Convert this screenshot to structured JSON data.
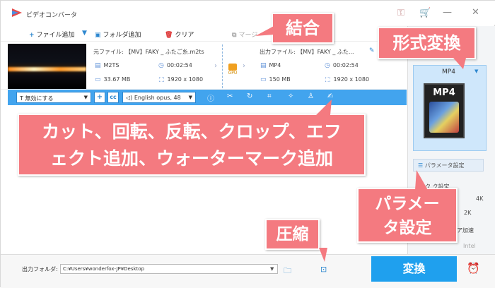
{
  "window": {
    "title": "ビデオコンバータ"
  },
  "toolbar": {
    "add_file": "ファイル追加",
    "add_folder": "フォルダ追加",
    "clear": "クリア",
    "merge": "マージ"
  },
  "file": {
    "source_label": "元ファイル:",
    "source_name": "【MV】FAKY _ ふたご糸.m2ts",
    "source_format": "M2TS",
    "source_duration": "00:02:54",
    "source_size": "33.67 MB",
    "source_resolution": "1920 x 1080",
    "gpu_label": "GPU",
    "output_label": "出力ファイル:",
    "output_name": "【MV】FAKY _ ふた...",
    "output_format": "MP4",
    "output_duration": "00:02:54",
    "output_size": "150 MB",
    "output_resolution": "1920 x 1080"
  },
  "editbar": {
    "subtitle_select": "無効にする",
    "audio_select": "English opus, 48",
    "add_button": "+",
    "cc_button": "cc"
  },
  "right_panel": {
    "format_label": "MP4",
    "format_icon_text": "MP4",
    "param_button": "パラメータ設定",
    "quality_label": "ク",
    "quality_label_2": "ク設定",
    "quality_value": "4K",
    "quality_value_2": "2K",
    "hw_accel": "ア加速",
    "intel": "Intel"
  },
  "bottom": {
    "output_folder_label": "出力フォルダ:",
    "output_path": "C:¥Users¥wonderfox-JP¥Desktop",
    "convert_button": "変換"
  },
  "callouts": {
    "merge": "結合",
    "format": "形式変換",
    "edit_line1": "カット、回転、反転、クロップ、エフ",
    "edit_line2": "ェクト追加、ウォーターマーク追加",
    "param_line1": "パラメー",
    "param_line2": "タ設定",
    "compress": "圧縮"
  },
  "colors": {
    "accent": "#1fa0ee",
    "editbar": "#42a4ee",
    "callout": "#f47a80"
  }
}
